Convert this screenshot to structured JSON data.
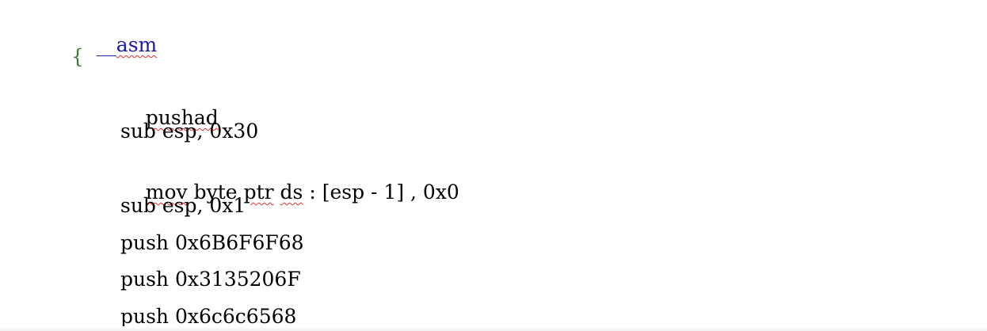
{
  "code": {
    "asm_keyword_prefix": "__",
    "asm_keyword": "asm",
    "open_brace": "{",
    "lines": [
      {
        "text": "pushad"
      },
      {
        "text": "sub esp, 0x30"
      },
      {
        "text_parts": [
          "mov",
          " byte ",
          "ptr",
          " ",
          "ds",
          " : [esp - 1] , 0x0"
        ]
      },
      {
        "text": "sub esp, 0x1"
      },
      {
        "text": "push 0x6B6F6F68"
      },
      {
        "text": "push 0x3135206F"
      },
      {
        "text": "push 0x6c6c6568"
      }
    ]
  },
  "colors": {
    "keyword": "#1a1aa6",
    "brace": "#2e7d32",
    "spellcheck": "#e03030"
  }
}
